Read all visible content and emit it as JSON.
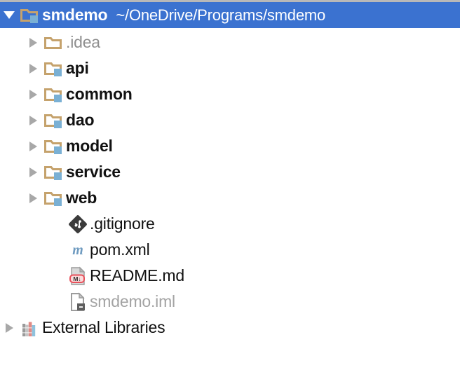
{
  "panel": {
    "name": "project-tree",
    "background_color": "#ffffff",
    "selection_color": "#3b72d0",
    "selected_text_color": "#ffffff"
  },
  "rows": [
    {
      "label": "smdemo",
      "secondary_label": "~/OneDrive/Programs/smdemo",
      "icon": "module-folder-icon",
      "arrow": "chevron-down-icon",
      "expanded": true,
      "selected": true,
      "indent": 0,
      "style": "bold-white"
    },
    {
      "label": ".idea",
      "secondary_label": "",
      "icon": "folder-icon",
      "arrow": "chevron-right-icon",
      "expanded": false,
      "selected": false,
      "indent": 1,
      "style": "gray"
    },
    {
      "label": "api",
      "secondary_label": "",
      "icon": "module-folder-icon",
      "arrow": "chevron-right-icon",
      "expanded": false,
      "selected": false,
      "indent": 1,
      "style": "bold-dark"
    },
    {
      "label": "common",
      "secondary_label": "",
      "icon": "module-folder-icon",
      "arrow": "chevron-right-icon",
      "expanded": false,
      "selected": false,
      "indent": 1,
      "style": "bold-dark"
    },
    {
      "label": "dao",
      "secondary_label": "",
      "icon": "module-folder-icon",
      "arrow": "chevron-right-icon",
      "expanded": false,
      "selected": false,
      "indent": 1,
      "style": "bold-dark"
    },
    {
      "label": "model",
      "secondary_label": "",
      "icon": "module-folder-icon",
      "arrow": "chevron-right-icon",
      "expanded": false,
      "selected": false,
      "indent": 1,
      "style": "bold-dark"
    },
    {
      "label": "service",
      "secondary_label": "",
      "icon": "module-folder-icon",
      "arrow": "chevron-right-icon",
      "expanded": false,
      "selected": false,
      "indent": 1,
      "style": "bold-dark"
    },
    {
      "label": "web",
      "secondary_label": "",
      "icon": "module-folder-icon",
      "arrow": "chevron-right-icon",
      "expanded": false,
      "selected": false,
      "indent": 1,
      "style": "bold-dark"
    },
    {
      "label": ".gitignore",
      "secondary_label": "",
      "icon": "git-file-icon",
      "arrow": "none",
      "expanded": false,
      "selected": false,
      "indent": 2,
      "style": "dark"
    },
    {
      "label": "pom.xml",
      "secondary_label": "",
      "icon": "maven-file-icon",
      "arrow": "none",
      "expanded": false,
      "selected": false,
      "indent": 2,
      "style": "dark"
    },
    {
      "label": "README.md",
      "secondary_label": "",
      "icon": "markdown-file-icon",
      "arrow": "none",
      "expanded": false,
      "selected": false,
      "indent": 2,
      "style": "dark"
    },
    {
      "label": "smdemo.iml",
      "secondary_label": "",
      "icon": "iml-file-icon",
      "arrow": "none",
      "expanded": false,
      "selected": false,
      "indent": 2,
      "style": "muted"
    },
    {
      "label": "External Libraries",
      "secondary_label": "",
      "icon": "library-books-icon",
      "arrow": "chevron-right-icon",
      "expanded": false,
      "selected": false,
      "indent": 0,
      "style": "dark"
    }
  ],
  "colors": {
    "folder_tan": "#c5a26c",
    "module_badge_blue": "#7ab0d4",
    "arrow_gray": "#a8a8a8",
    "git_dark": "#3b3b3b",
    "maven_blue": "#6f9bc0",
    "markdown_red": "#e8505b",
    "page_gray": "#b0b0b0",
    "book_red": "#e08a85",
    "book_blue": "#8fc2dd",
    "book_gray": "#9a9a9a"
  }
}
